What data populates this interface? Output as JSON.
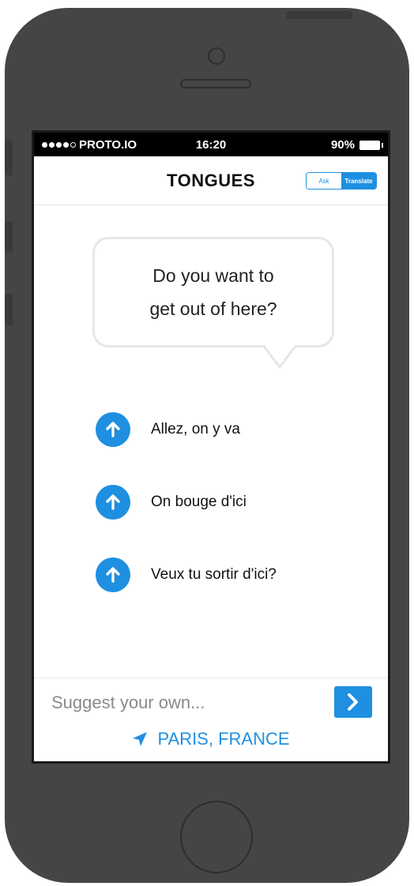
{
  "status_bar": {
    "carrier": "PROTO.IO",
    "time": "16:20",
    "battery": "90%"
  },
  "nav": {
    "title": "TONGUES",
    "segments": [
      "Ask",
      "Translate"
    ],
    "selected_segment": "Translate"
  },
  "prompt": {
    "line1": "Do you want to",
    "line2": "get out of here?"
  },
  "options": [
    {
      "text": "Allez, on y va",
      "icon": "arrow-up-icon"
    },
    {
      "text": "On bouge d'ici",
      "icon": "arrow-up-icon"
    },
    {
      "text": "Veux tu sortir d'ici?",
      "icon": "arrow-up-icon"
    }
  ],
  "suggest": {
    "placeholder": "Suggest your own...",
    "value": ""
  },
  "location": {
    "text": "PARIS, FRANCE",
    "icon": "location-arrow-icon"
  },
  "colors": {
    "accent": "#1e8fe1",
    "phone_body": "#454545",
    "status_bar": "#000000"
  }
}
